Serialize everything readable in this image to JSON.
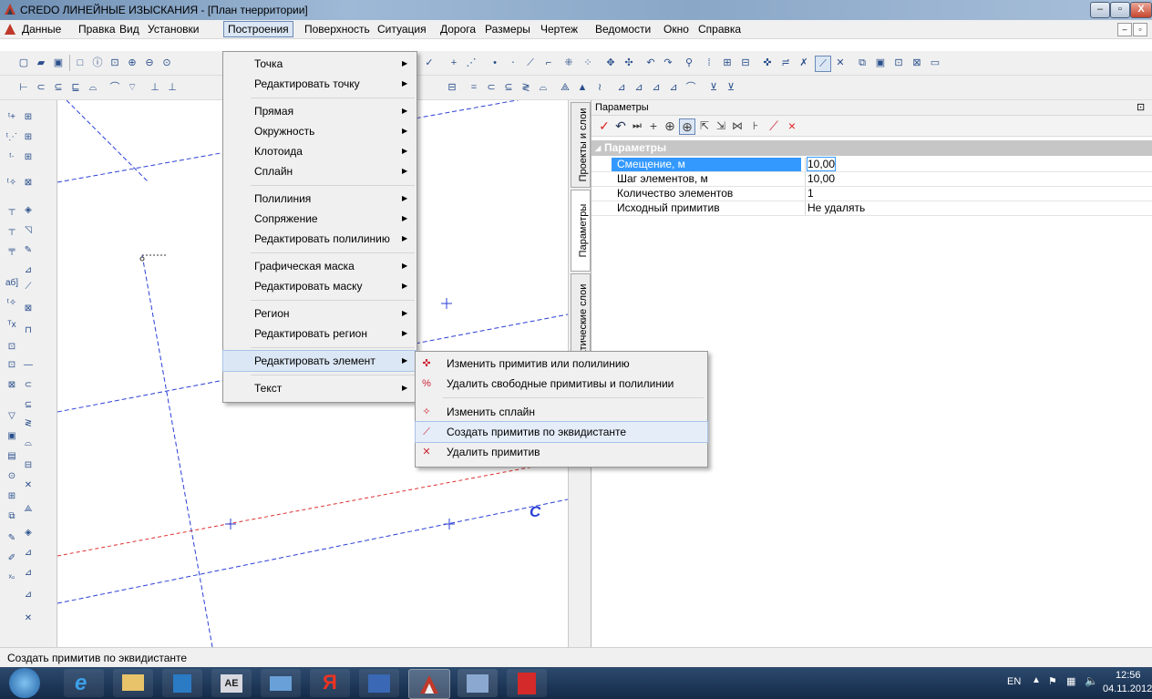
{
  "window": {
    "title": "CREDO ЛИНЕЙНЫЕ ИЗЫСКАНИЯ - [План тнерритории]",
    "minimize": "–",
    "maximize": "▫",
    "close": "X"
  },
  "menubar": {
    "items": [
      "Данные",
      "Правка",
      "Вид",
      "Установки",
      "Построения",
      "Поверхность",
      "Ситуация",
      "Дорога",
      "Размеры",
      "Чертеж",
      "Ведомости",
      "Окно",
      "Справка"
    ],
    "active": "Построения"
  },
  "build_menu": {
    "items": [
      {
        "label": "Точка"
      },
      {
        "label": "Редактировать точку"
      },
      {
        "label": "Прямая"
      },
      {
        "label": "Окружность"
      },
      {
        "label": "Клотоида"
      },
      {
        "label": "Сплайн"
      },
      {
        "label": "Полилиния"
      },
      {
        "label": "Сопряжение"
      },
      {
        "label": "Редактировать полилинию"
      },
      {
        "label": "Графическая маска"
      },
      {
        "label": "Редактировать маску"
      },
      {
        "label": "Регион"
      },
      {
        "label": "Редактировать регион"
      },
      {
        "label": "Редактировать элемент"
      },
      {
        "label": "Текст"
      }
    ],
    "highlighted": "Редактировать элемент"
  },
  "edit_element_submenu": {
    "items": [
      {
        "label": "Изменить примитив или полилинию",
        "icon": "modify-primitive-icon"
      },
      {
        "label": "Удалить свободные примитивы и полилинии",
        "icon": "delete-free-primitives-icon"
      },
      {
        "label": "Изменить сплайн",
        "icon": "modify-spline-icon"
      },
      {
        "label": "Создать примитив по эквидистанте",
        "icon": "equidistant-primitive-icon"
      },
      {
        "label": "Удалить примитив",
        "icon": "delete-primitive-icon"
      }
    ],
    "highlighted": "Создать примитив по эквидистанте"
  },
  "side_tabs": [
    "Проекты и слои",
    "Параметры",
    "атические слои"
  ],
  "params_panel": {
    "title": "Параметры",
    "group": "Параметры",
    "rows": [
      {
        "key": "Смещение, м",
        "value": "10,00"
      },
      {
        "key": "Шаг элементов, м",
        "value": "10,00"
      },
      {
        "key": "Количество элементов",
        "value": "1"
      },
      {
        "key": "Исходный примитив",
        "value": "Не удалять"
      }
    ]
  },
  "canvas": {
    "label": "C"
  },
  "status": {
    "text": "Создать примитив по эквидистанте"
  },
  "taskbar": {
    "lang": "EN",
    "time": "12:56",
    "date": "04.11.2012"
  },
  "colors": {
    "axis_blue": "#2a3fd6",
    "offset_red": "#e03030",
    "menu_highlight": "#dce7f5",
    "selection": "#3399ff"
  }
}
